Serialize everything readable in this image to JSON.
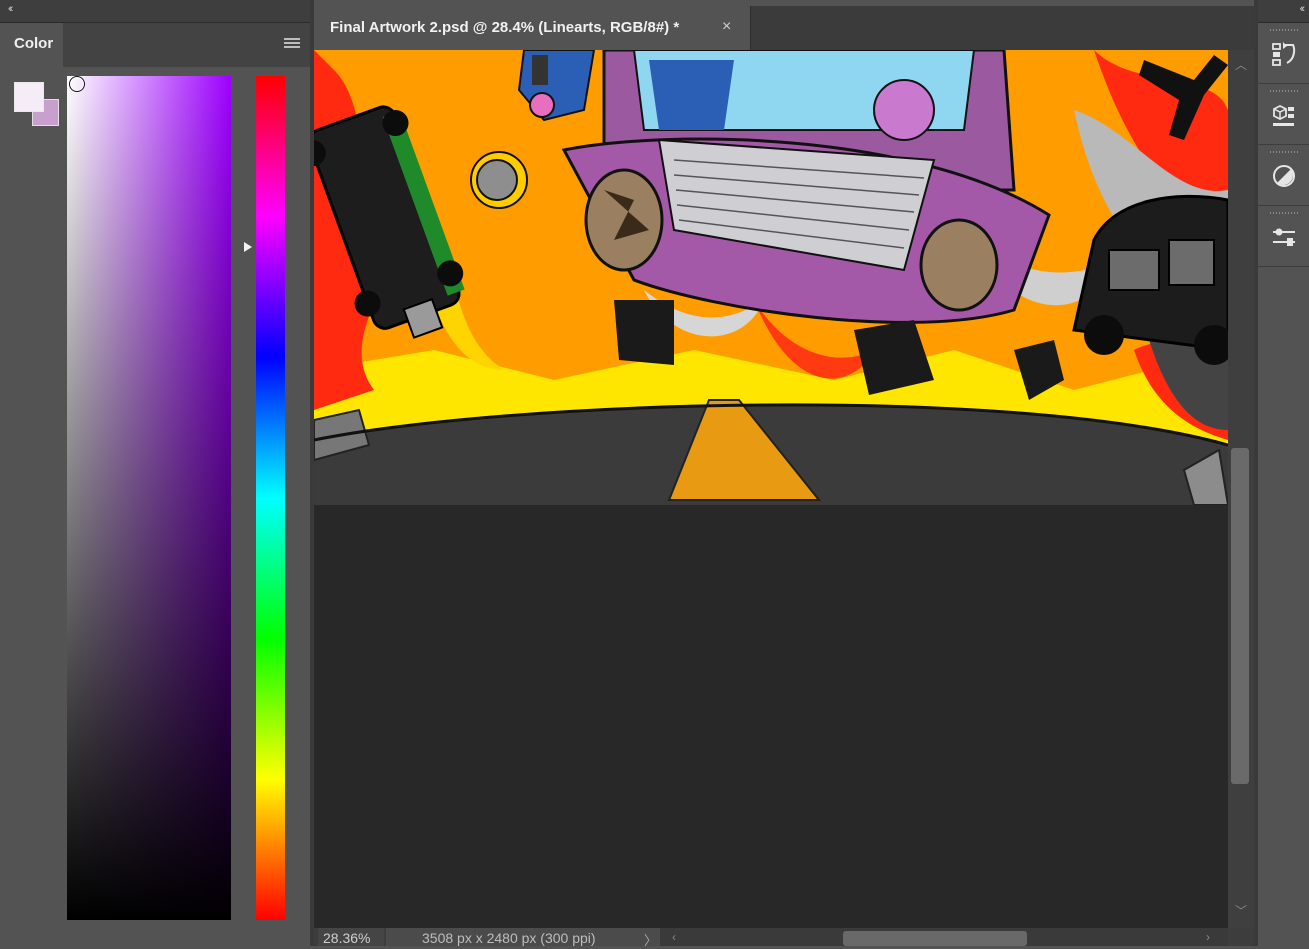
{
  "left_panel": {
    "collapse_icon": "double-chevron-left-icon",
    "tab_label": "Color",
    "menu_icon": "hamburger-menu-icon",
    "foreground_color": "#f6ecf8",
    "background_color": "#c9a0cd",
    "hue_color": "#9d00ff"
  },
  "document": {
    "tab_title": "Final Artwork 2.psd @ 28.4% (Linearts, RGB/8#) *",
    "close_label": "×",
    "artwork_icon": "artwork-image"
  },
  "status_bar": {
    "zoom": "28.36%",
    "doc_info": "3508 px x 2480 px (300 ppi)",
    "info_arrow": "〉",
    "scroll_left": "‹",
    "scroll_right": "›",
    "scroll_up": "︿",
    "scroll_down": "﹀"
  },
  "right_dock": {
    "collapse_icon": "double-chevron-right-icon",
    "buttons": [
      "history-icon",
      "libraries-3d-icon",
      "adjustments-icon",
      "properties-icon"
    ]
  }
}
